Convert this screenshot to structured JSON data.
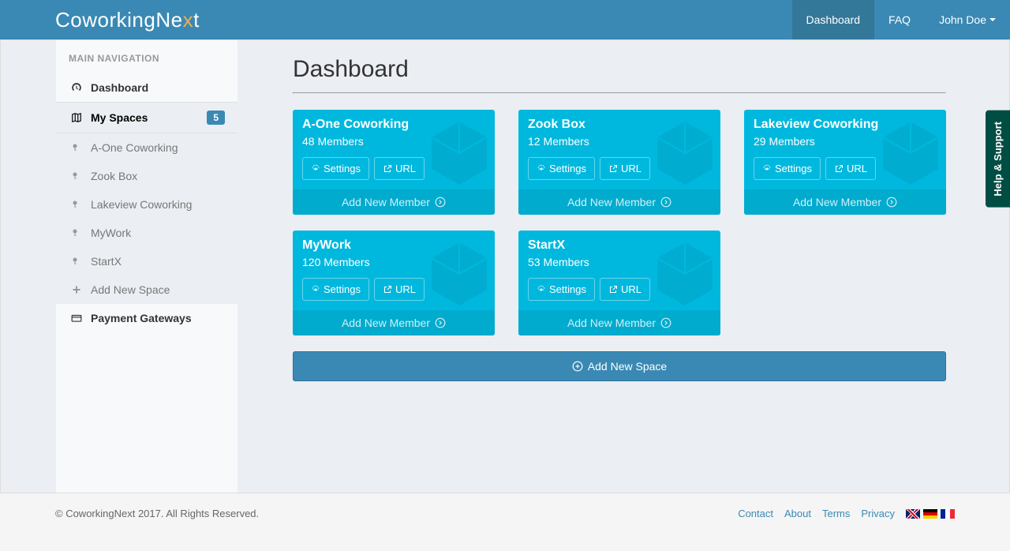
{
  "navbar": {
    "logo_pre": "CoworkingNe",
    "logo_x": "x",
    "logo_post": "t",
    "links": {
      "dashboard": "Dashboard",
      "faq": "FAQ",
      "user": "John Doe"
    }
  },
  "sidebar": {
    "header": "MAIN NAVIGATION",
    "dashboard": "Dashboard",
    "my_spaces": "My Spaces",
    "my_spaces_count": "5",
    "spaces": [
      "A-One Coworking",
      "Zook Box",
      "Lakeview Coworking",
      "MyWork",
      "StartX"
    ],
    "add_new_space": "Add New Space",
    "payment_gateways": "Payment Gateways"
  },
  "main": {
    "title": "Dashboard",
    "cards": [
      {
        "name": "A-One Coworking",
        "members": "48 Members"
      },
      {
        "name": "Zook Box",
        "members": "12 Members"
      },
      {
        "name": "Lakeview Coworking",
        "members": "29 Members"
      },
      {
        "name": "MyWork",
        "members": "120 Members"
      },
      {
        "name": "StartX",
        "members": "53 Members"
      }
    ],
    "settings_label": "Settings",
    "url_label": "URL",
    "add_member_label": "Add New Member",
    "add_space_label": "Add New Space"
  },
  "footer": {
    "copyright": "© CoworkingNext 2017. All Rights Reserved.",
    "links": {
      "contact": "Contact",
      "about": "About",
      "terms": "Terms",
      "privacy": "Privacy"
    }
  },
  "help": {
    "label": "Help & Support"
  }
}
